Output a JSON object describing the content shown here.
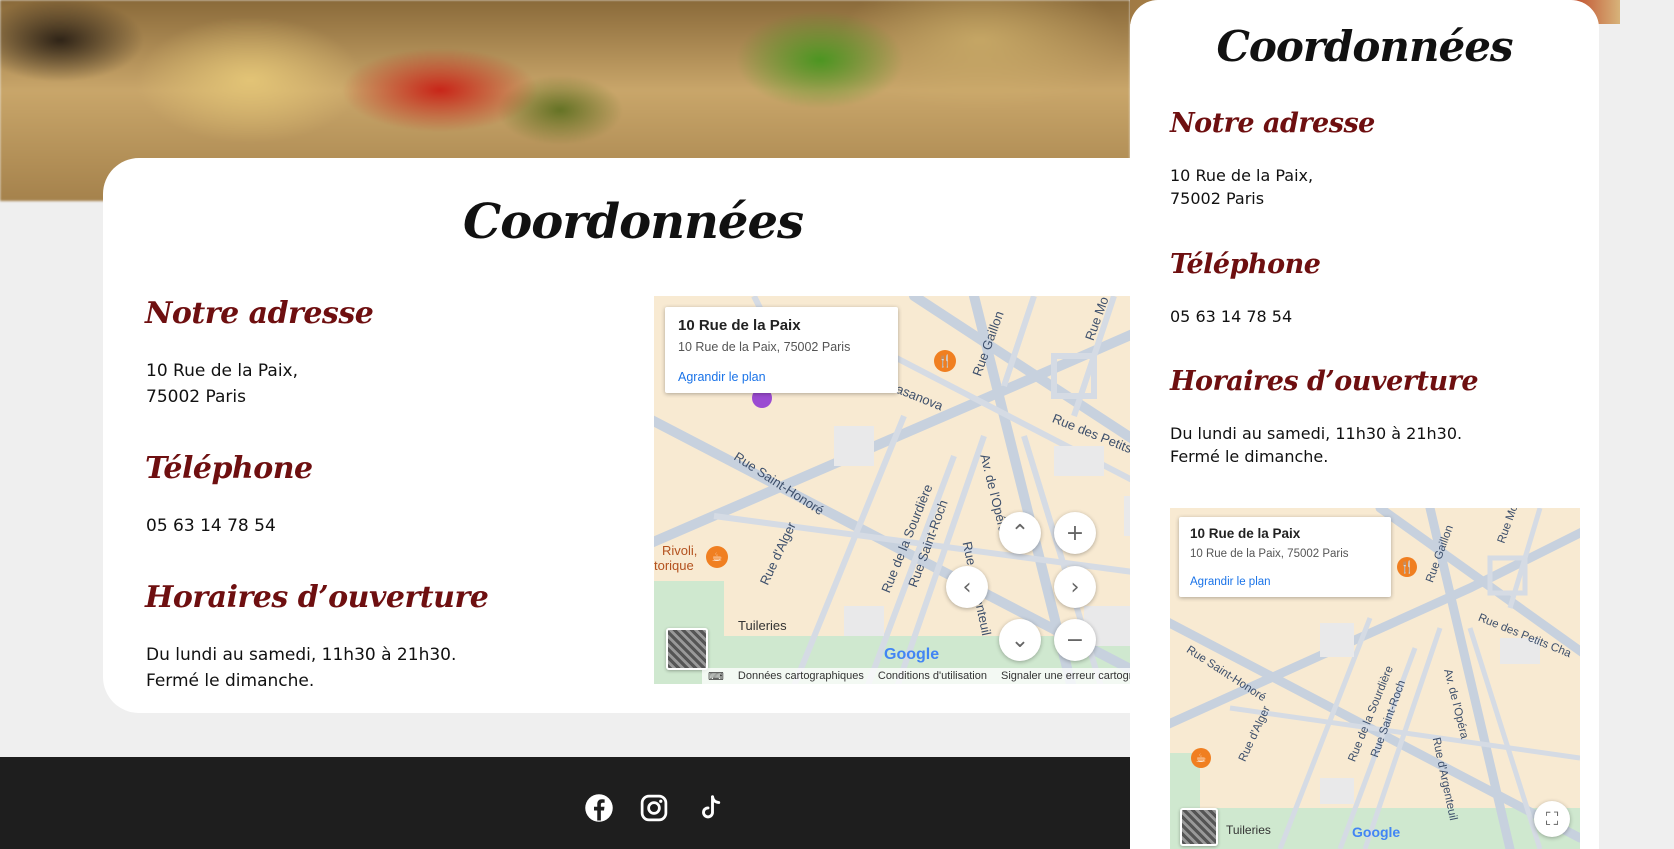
{
  "section": {
    "title": "Coordonnées",
    "address_heading": "Notre adresse",
    "address_lines": [
      "10 Rue de la Paix,",
      "75002 Paris"
    ],
    "phone_heading": "Téléphone",
    "phone": "05 63 14 78 54",
    "hours_heading": "Horaires d’ouverture",
    "hours_lines": [
      "Du lundi au samedi, 11h30 à 21h30.",
      "Fermé le dimanche."
    ]
  },
  "map": {
    "place_title": "10 Rue de la Paix",
    "place_address": "10 Rue de la Paix, 75002 Paris",
    "enlarge_link": "Agrandir le plan",
    "attribution_data": "Données cartographiques",
    "attribution_terms": "Conditions d'utilisation",
    "attribution_report": "Signaler une erreur cartograp",
    "google_logo": "Google",
    "street_labels": [
      "Rue Saint-Honoré",
      "Rue d'Alger",
      "Rue de la Sourdière",
      "Rue Saint-Roch",
      "Rue des Petits Cha",
      "Rue Gaillon",
      "Casanova",
      "Av. de l'Opéra",
      "Rue d'Argenteuil",
      "Tuileries",
      "Rivoli,",
      "torique",
      "Rue Mo"
    ],
    "controls": {
      "zoom_in": "+",
      "zoom_out": "−",
      "pan_up": "⌃",
      "pan_down": "⌄",
      "pan_left": "‹",
      "pan_right": "›"
    }
  },
  "footer": {
    "social_icons": [
      "facebook-icon",
      "instagram-icon",
      "tiktok-icon"
    ]
  },
  "colors": {
    "accent_heading": "#6e0f10",
    "footer_bg": "#1e1e1e",
    "page_bg": "#efefef",
    "map_link": "#1a73e8"
  }
}
